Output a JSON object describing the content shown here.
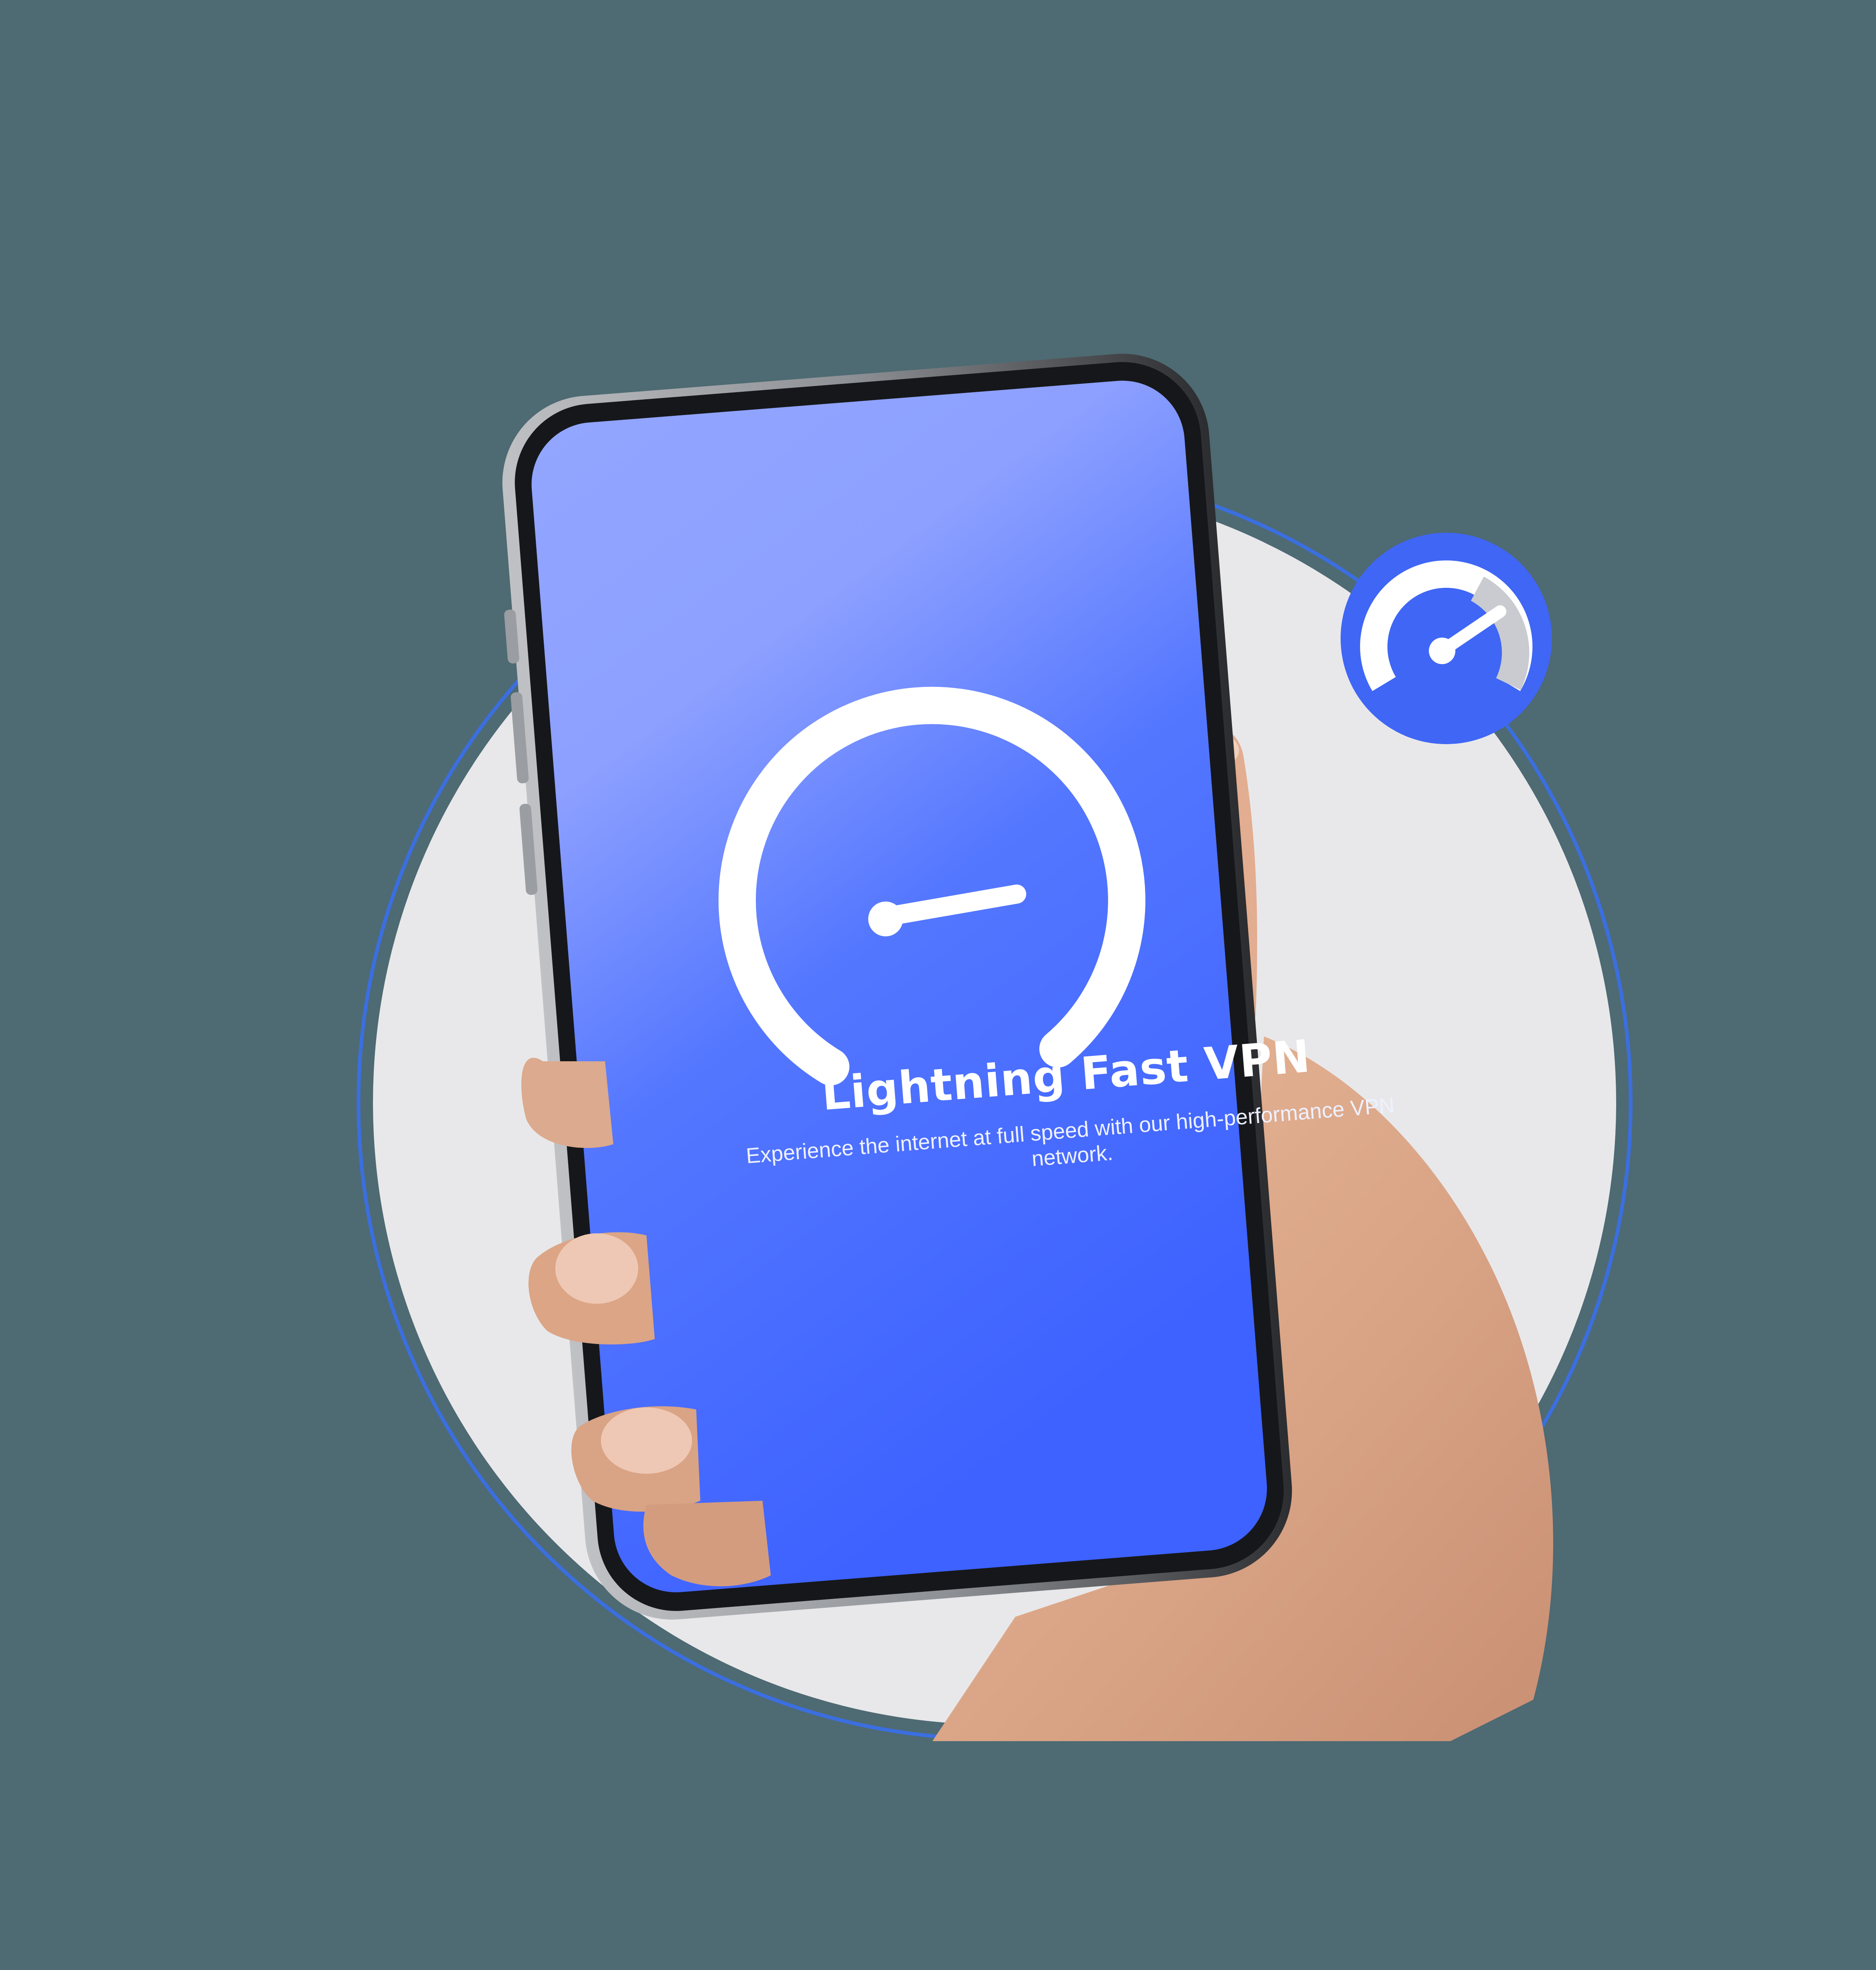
{
  "screen": {
    "title": "Lightning Fast VPN",
    "subtitle": "Experience the internet at full speed with our high-performance VPN network."
  },
  "icons": {
    "main_gauge": "speedometer-gauge-icon",
    "badge": "speedometer-badge-icon"
  },
  "colors": {
    "background": "#4e6a73",
    "circle_fill": "#e8e8ea",
    "ring_stroke": "#3b6fe0",
    "screen_top": "#92a6ff",
    "screen_bottom": "#3d62ff",
    "badge_blue": "#3f66f5",
    "badge_gray": "#c9cbd0"
  }
}
